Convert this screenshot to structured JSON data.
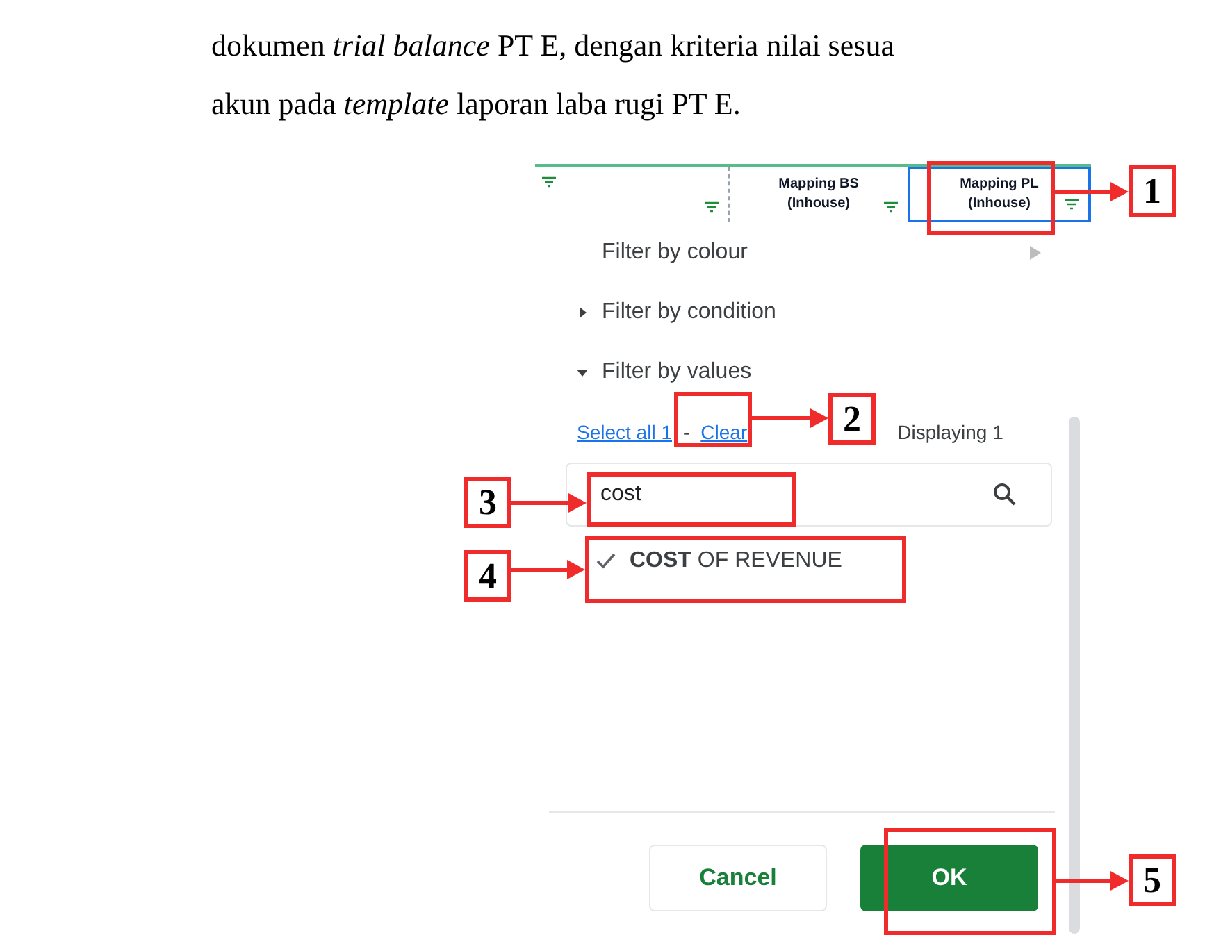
{
  "paragraph": {
    "lines": [
      "dokumen *trial balance* PT E, dengan kriteria nilai sesua",
      "akun pada *template* laporan laba rugi PT E."
    ]
  },
  "sheet": {
    "columns": [
      {
        "label": "Mapping BS (Inhouse)",
        "selected": false
      },
      {
        "label": "Mapping PL (Inhouse)",
        "selected": true
      }
    ]
  },
  "filter_menu": {
    "items": [
      {
        "label": "Filter by colour",
        "kind": "submenu"
      },
      {
        "label": "Filter by condition",
        "kind": "section",
        "expanded": false
      },
      {
        "label": "Filter by values",
        "kind": "section",
        "expanded": true
      }
    ],
    "select_all": "Select all 1",
    "separator": "-",
    "clear": "Clear",
    "displaying": "Displaying 1",
    "search": {
      "value": "cost"
    },
    "values": [
      {
        "label": "**COST** OF REVENUE",
        "checked": true
      }
    ],
    "buttons": [
      {
        "label": "Cancel",
        "kind": "secondary"
      },
      {
        "label": "OK",
        "kind": "primary"
      }
    ]
  },
  "callouts": [
    "1",
    "2",
    "3",
    "4",
    "5"
  ]
}
